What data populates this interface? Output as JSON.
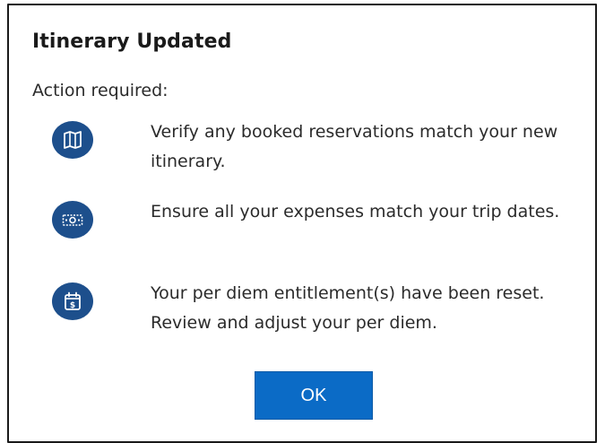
{
  "dialog": {
    "title": "Itinerary Updated",
    "subtitle": "Action required:",
    "items": [
      {
        "icon": "map-icon",
        "text": "Verify any booked reservations match your new itinerary."
      },
      {
        "icon": "money-icon",
        "text": "Ensure all your expenses match your trip dates."
      },
      {
        "icon": "calendar-dollar-icon",
        "text": "Your per diem entitlement(s) have been reset. Review and adjust your per diem."
      }
    ],
    "ok_label": "OK"
  },
  "colors": {
    "icon_circle": "#1d4f8c",
    "button": "#0b6bc6",
    "border": "#1a1a1a"
  }
}
